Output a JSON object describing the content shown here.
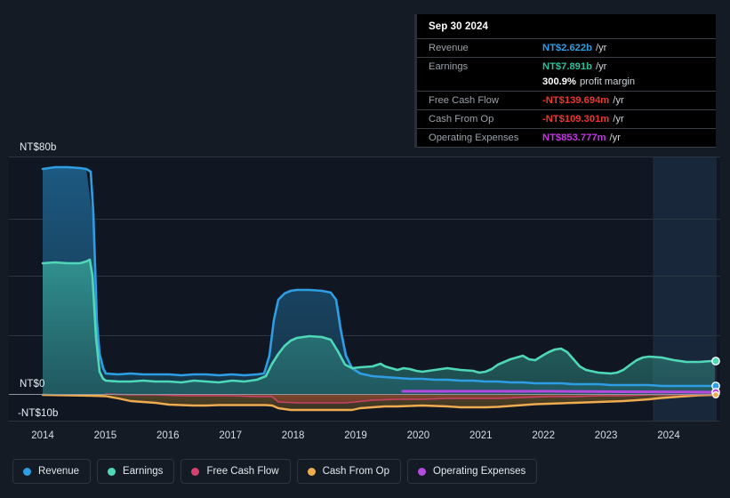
{
  "background": "#141b24",
  "tooltip": {
    "date": "Sep 30 2024",
    "rows": [
      {
        "key": "Revenue",
        "value": "NT$2.622b",
        "unit": "/yr",
        "color": "#2e9ee4"
      },
      {
        "key": "Earnings",
        "value": "NT$7.891b",
        "unit": "/yr",
        "color": "#2fbf9a"
      },
      {
        "key": "",
        "value": "300.9%",
        "unit": "profit margin",
        "color": "#ffffff"
      },
      {
        "key": "Free Cash Flow",
        "value": "-NT$139.694m",
        "unit": "/yr",
        "color": "#e8392f"
      },
      {
        "key": "Cash From Op",
        "value": "-NT$109.301m",
        "unit": "/yr",
        "color": "#e8392f"
      },
      {
        "key": "Operating Expenses",
        "value": "NT$853.777m",
        "unit": "/yr",
        "color": "#c23ae0"
      }
    ]
  },
  "legend": {
    "items": [
      {
        "label": "Revenue",
        "color": "#2e9ee4"
      },
      {
        "label": "Earnings",
        "color": "#4fd8b8"
      },
      {
        "label": "Free Cash Flow",
        "color": "#d6416f"
      },
      {
        "label": "Cash From Op",
        "color": "#eeab50"
      },
      {
        "label": "Operating Expenses",
        "color": "#b44ae0"
      }
    ]
  },
  "axis": {
    "y_labels": [
      {
        "text": "NT$80b",
        "value": 80
      },
      {
        "text": "NT$0",
        "value": 0
      },
      {
        "text": "-NT$10b",
        "value": -10
      }
    ],
    "x_labels": [
      "2014",
      "2015",
      "2016",
      "2017",
      "2018",
      "2019",
      "2020",
      "2021",
      "2022",
      "2023",
      "2024"
    ]
  },
  "chart_data": {
    "type": "area",
    "title": "",
    "xlabel": "",
    "ylabel": "",
    "ylim": [
      -10,
      80
    ],
    "xlim": [
      2013.8,
      2024.9
    ],
    "grid": true,
    "legend_position": "bottom",
    "currency": "NT$",
    "x": [
      2013.8,
      2014.0,
      2014.25,
      2014.5,
      2014.6,
      2014.72,
      2014.85,
      2015.0,
      2015.25,
      2015.5,
      2015.75,
      2016.0,
      2016.25,
      2016.5,
      2016.75,
      2017.0,
      2017.25,
      2017.5,
      2017.7,
      2017.8,
      2017.95,
      2018.1,
      2018.3,
      2018.5,
      2018.7,
      2018.85,
      2018.95,
      2019.1,
      2019.3,
      2019.5,
      2019.75,
      2020.0,
      2020.25,
      2020.5,
      2020.75,
      2021.0,
      2021.25,
      2021.5,
      2021.75,
      2022.0,
      2022.25,
      2022.5,
      2022.75,
      2023.0,
      2023.25,
      2023.5,
      2023.75,
      2024.0,
      2024.25,
      2024.5,
      2024.75
    ],
    "series": [
      {
        "name": "Revenue",
        "color": "#2e9ee4",
        "values": [
          72.0,
          72.3,
          72.4,
          72.3,
          72.0,
          45.0,
          12.0,
          4.2,
          4.0,
          4.1,
          4.0,
          4.0,
          4.0,
          3.9,
          4.0,
          4.0,
          3.9,
          4.0,
          4.2,
          10.0,
          28.0,
          36.0,
          36.5,
          36.4,
          36.2,
          34.0,
          20.0,
          9.0,
          6.0,
          4.6,
          4.2,
          3.9,
          3.8,
          3.7,
          3.6,
          3.5,
          3.4,
          3.3,
          3.2,
          3.1,
          3.0,
          3.0,
          2.9,
          2.85,
          2.8,
          2.75,
          2.7,
          2.68,
          2.65,
          2.63,
          2.622
        ]
      },
      {
        "name": "Earnings",
        "color": "#4fd8b8",
        "values": [
          37.0,
          37.2,
          37.0,
          36.9,
          37.0,
          38.8,
          24.0,
          2.5,
          2.4,
          2.3,
          2.6,
          2.4,
          2.3,
          2.1,
          2.6,
          2.4,
          2.2,
          2.5,
          2.8,
          6.0,
          12.0,
          17.0,
          20.0,
          20.5,
          20.2,
          17.0,
          9.0,
          5.5,
          5.0,
          5.2,
          5.8,
          5.4,
          5.0,
          5.6,
          5.2,
          4.4,
          4.6,
          5.4,
          6.5,
          7.6,
          8.6,
          7.8,
          7.6,
          9.4,
          9.9,
          7.8,
          5.6,
          4.8,
          5.3,
          7.6,
          7.891
        ]
      },
      {
        "name": "Free Cash Flow",
        "color": "#d6416f",
        "values": [
          0,
          0,
          0,
          0,
          0,
          0,
          0,
          -0.25,
          -0.3,
          -0.35,
          -0.4,
          -0.45,
          -0.45,
          -0.5,
          -0.5,
          -0.55,
          -0.55,
          -0.6,
          -0.6,
          -0.6,
          -0.6,
          -1.3,
          -1.5,
          -1.5,
          -1.5,
          -1.5,
          -1.5,
          -1.5,
          -1.2,
          -1.0,
          -0.9,
          -0.9,
          -0.85,
          -0.8,
          -0.8,
          -0.8,
          -0.8,
          -0.75,
          -0.7,
          -0.6,
          -0.55,
          -0.5,
          -0.45,
          -0.4,
          -0.35,
          -0.3,
          -0.25,
          -0.2,
          -0.18,
          -0.15,
          -0.14
        ]
      },
      {
        "name": "Cash From Op",
        "color": "#eeab50",
        "values": [
          -0.15,
          -0.2,
          -0.25,
          -0.3,
          -0.3,
          -0.35,
          -0.4,
          -0.45,
          -0.7,
          -0.95,
          -1.1,
          -1.15,
          -1.2,
          -1.5,
          -1.55,
          -1.5,
          -1.45,
          -1.45,
          -1.45,
          -1.45,
          -1.45,
          -1.5,
          -2.0,
          -2.3,
          -2.3,
          -2.3,
          -2.3,
          -2.25,
          -2.1,
          -1.9,
          -1.8,
          -1.8,
          -1.75,
          -1.7,
          -1.75,
          -1.9,
          -1.9,
          -1.85,
          -1.8,
          -1.7,
          -1.5,
          -1.3,
          -1.2,
          -1.1,
          -1.0,
          -0.9,
          -0.8,
          -0.6,
          -0.4,
          -0.25,
          -0.11
        ]
      },
      {
        "name": "Operating Expenses",
        "color": "#b44ae0",
        "start_x": 2019.62,
        "values_from_start": [
          0.9,
          0.9,
          0.9,
          0.9,
          0.9,
          0.9,
          0.9,
          0.9,
          0.9,
          0.9,
          0.9,
          0.9,
          0.9,
          0.88,
          0.88,
          0.87,
          0.86,
          0.86,
          0.855,
          0.854,
          0.8538
        ]
      }
    ],
    "highlight_band": {
      "from_x": 2023.9,
      "to_x": 2024.9
    },
    "marker_x": 2024.75
  }
}
